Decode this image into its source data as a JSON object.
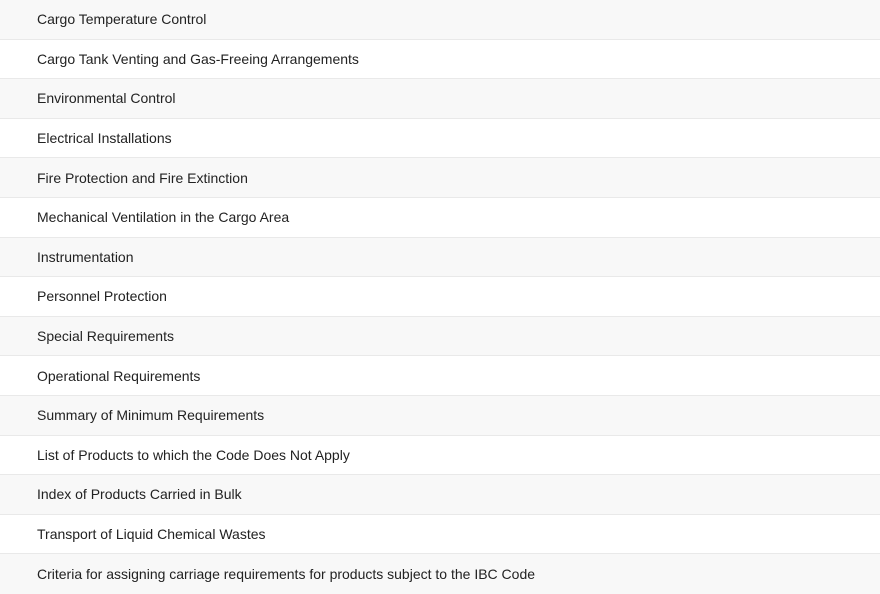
{
  "toc": {
    "items": [
      {
        "label": "Cargo Temperature Control"
      },
      {
        "label": "Cargo Tank Venting and Gas-Freeing Arrangements"
      },
      {
        "label": "Environmental Control"
      },
      {
        "label": "Electrical Installations"
      },
      {
        "label": "Fire Protection and Fire Extinction"
      },
      {
        "label": "Mechanical Ventilation in the Cargo Area"
      },
      {
        "label": "Instrumentation"
      },
      {
        "label": "Personnel Protection"
      },
      {
        "label": "Special Requirements"
      },
      {
        "label": "Operational Requirements"
      },
      {
        "label": "Summary of Minimum Requirements"
      },
      {
        "label": "List of Products to which the Code Does Not Apply"
      },
      {
        "label": "Index of Products Carried in Bulk"
      },
      {
        "label": "Transport of Liquid Chemical Wastes"
      },
      {
        "label": "Criteria for assigning carriage requirements for products subject to the IBC Code"
      }
    ]
  }
}
